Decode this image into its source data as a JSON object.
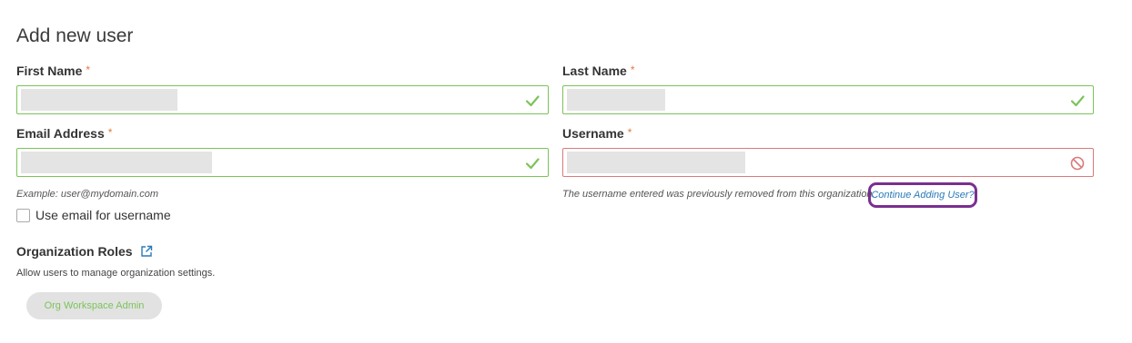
{
  "page": {
    "title": "Add new user"
  },
  "form": {
    "first_name": {
      "label": "First Name",
      "required_mark": "*",
      "value": ""
    },
    "last_name": {
      "label": "Last Name",
      "required_mark": "*",
      "value": ""
    },
    "email": {
      "label": "Email Address",
      "required_mark": "*",
      "value": "",
      "hint": "Example: user@mydomain.com"
    },
    "username": {
      "label": "Username",
      "required_mark": "*",
      "value": "",
      "error_text": "The username entered was previously removed from this organization.",
      "error_link": "Continue Adding User?"
    },
    "use_email_checkbox": {
      "label": "Use email for username",
      "checked": false
    }
  },
  "roles": {
    "title": "Organization Roles",
    "description": "Allow users to manage organization settings.",
    "chips": [
      {
        "label": "Org Workspace Admin"
      }
    ]
  },
  "icons": {
    "valid": "check-icon",
    "invalid": "prohibited-icon",
    "external": "external-link-icon"
  },
  "colors": {
    "valid": "#7cc35a",
    "invalid": "#d97a7a",
    "required": "#e07a3c",
    "link": "#2a7ab8",
    "highlight": "#7a2f8f"
  }
}
